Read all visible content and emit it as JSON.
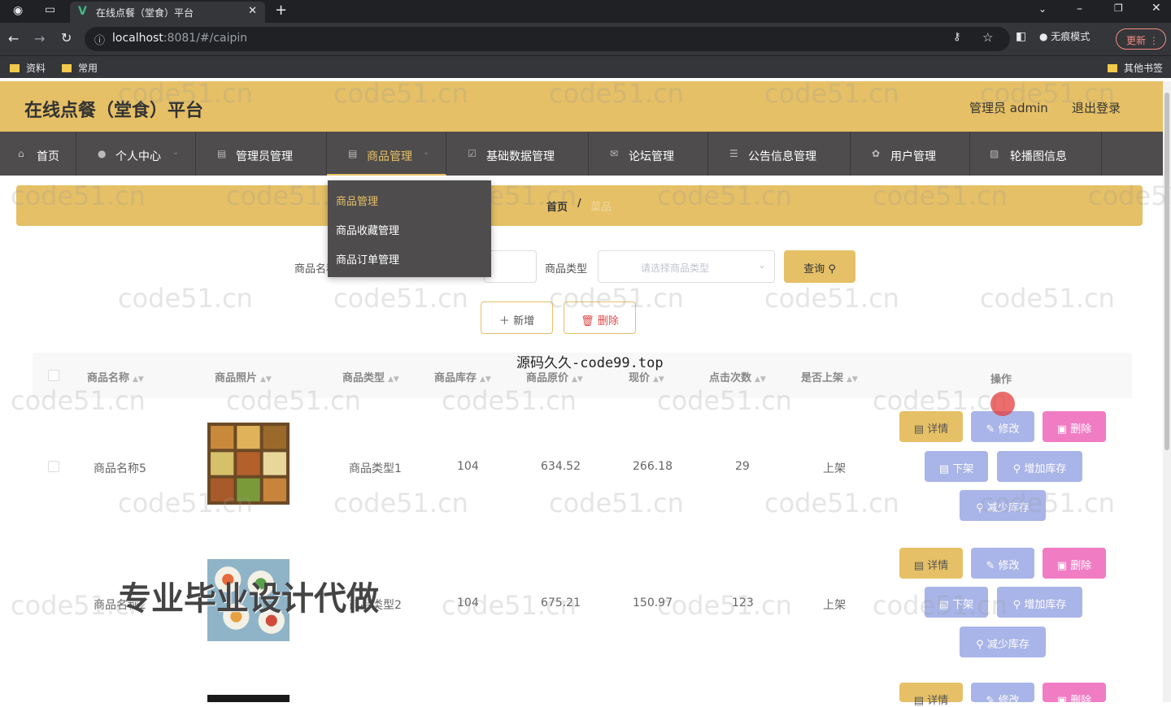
{
  "browser": {
    "tab_title": "在线点餐（堂食）平台",
    "tab_favicon": "V",
    "url_host": "localhost",
    "url_rest": ":8081/#/caipin",
    "profile_label": "无痕模式",
    "update_label": "更新",
    "bookmarks": [
      "资料",
      "常用"
    ],
    "other_bookmarks": "其他书签"
  },
  "header": {
    "title": "在线点餐（堂食）平台",
    "admin": "管理员 admin",
    "logout": "退出登录"
  },
  "nav": [
    {
      "label": "首页",
      "icon": "home-icon"
    },
    {
      "label": "个人中心",
      "icon": "user-icon"
    },
    {
      "label": "管理员管理",
      "icon": "doc-icon"
    },
    {
      "label": "商品管理",
      "icon": "doc-icon"
    },
    {
      "label": "基础数据管理",
      "icon": "check-icon"
    },
    {
      "label": "论坛管理",
      "icon": "mail-icon"
    },
    {
      "label": "公告信息管理",
      "icon": "list-icon"
    },
    {
      "label": "用户管理",
      "icon": "gear-icon"
    },
    {
      "label": "轮播图信息",
      "icon": "image-icon"
    }
  ],
  "dropdown": [
    "商品管理",
    "商品收藏管理",
    "商品订单管理"
  ],
  "breadcrumb": {
    "home": "首页",
    "sep": "/",
    "current": "菜品"
  },
  "search": {
    "name_label": "商品名称",
    "type_label": "商品类型",
    "type_placeholder": "请选择商品类型",
    "search_button": "查询"
  },
  "actions": {
    "add": "新增",
    "delete": "删除"
  },
  "table": {
    "headers": [
      "商品名称",
      "商品照片",
      "商品类型",
      "商品库存",
      "商品原价",
      "现价",
      "点击次数",
      "是否上架",
      "操作"
    ],
    "rows": [
      {
        "name": "商品名称5",
        "type": "商品类型1",
        "stock": "104",
        "orig": "634.52",
        "price": "266.18",
        "clicks": "29",
        "status": "上架"
      },
      {
        "name": "商品名称2",
        "type": "商品类型2",
        "stock": "104",
        "orig": "675.21",
        "price": "150.97",
        "clicks": "123",
        "status": "上架"
      }
    ],
    "row_buttons": {
      "detail": "详情",
      "edit": "修改",
      "delete": "删除",
      "offshelf": "下架",
      "add_stock": "增加库存",
      "reduce_stock": "减少库存"
    }
  },
  "watermark": "code51.cn",
  "overlay_top": "源码久久-code99.top",
  "overlay_big": "专业毕业设计代做",
  "colors": {
    "accent": "#e6c066",
    "nav_bg": "#4e4c4c",
    "btn_blue": "#a9b4e8",
    "btn_pink": "#f07cc4"
  }
}
